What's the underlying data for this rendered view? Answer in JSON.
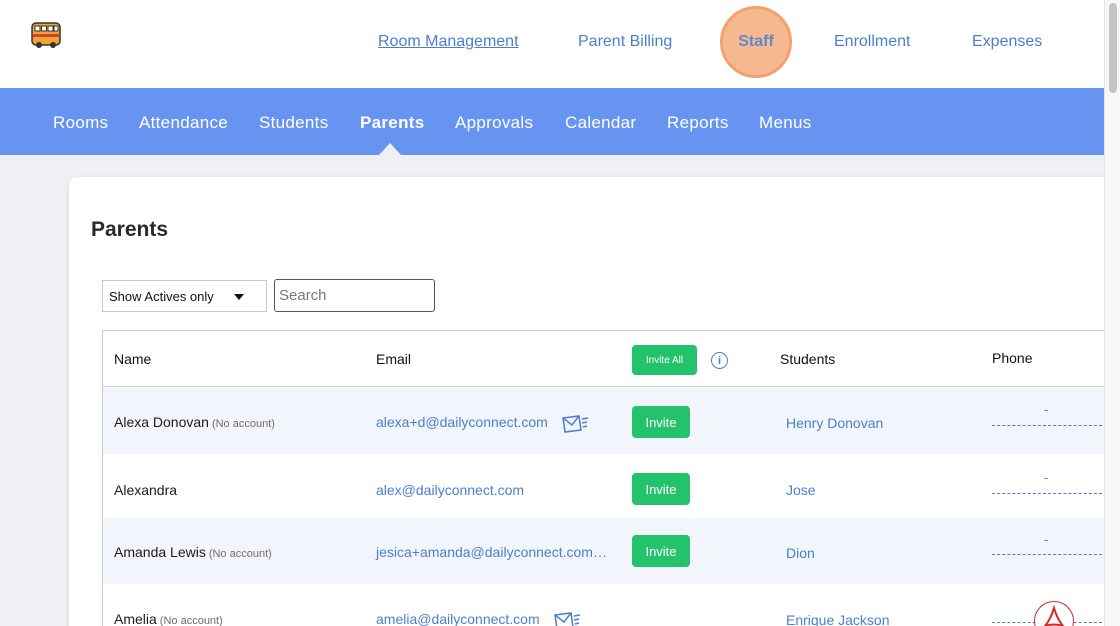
{
  "header": {
    "logo_icon": "school-bus-icon",
    "links": {
      "room_management": "Room Management",
      "parent_billing": "Parent Billing",
      "staff": "Staff",
      "enrollment": "Enrollment",
      "expenses": "Expenses"
    }
  },
  "nav": {
    "items": [
      "Rooms",
      "Attendance",
      "Students",
      "Parents",
      "Approvals",
      "Calendar",
      "Reports",
      "Menus"
    ],
    "active": "Parents"
  },
  "page": {
    "title": "Parents",
    "filter_selected": "Show Actives only",
    "search_placeholder": "Search"
  },
  "table": {
    "columns": {
      "name": "Name",
      "email": "Email",
      "invite_all": "Invite All",
      "students": "Students",
      "phone": "Phone"
    },
    "invite_label": "Invite",
    "no_account_label": "(No account)",
    "phone_placeholder": "-",
    "rows": [
      {
        "name": "Alexa Donovan",
        "no_account": "(No account)",
        "email": "alexa+d@dailyconnect.com",
        "student": "Henry Donovan",
        "phone": "-"
      },
      {
        "name": "Alexandra",
        "no_account": "",
        "email": "alex@dailyconnect.com",
        "student": "Jose",
        "phone": "-"
      },
      {
        "name": "Amanda Lewis",
        "no_account": "(No account)",
        "email": "jesica+amanda@dailyconnect.com…",
        "student": "Dion",
        "phone": "-"
      },
      {
        "name": "Amelia",
        "no_account": "(No account)",
        "email": "amelia@dailyconnect.com",
        "student": "Enrique Jackson",
        "phone": ""
      }
    ]
  },
  "colors": {
    "nav_bg": "#6694f0",
    "link": "#4a7fd0",
    "invite_button": "#24c26a",
    "staff_highlight": "#f6b98f",
    "row_shade": "#f2f5fb"
  }
}
